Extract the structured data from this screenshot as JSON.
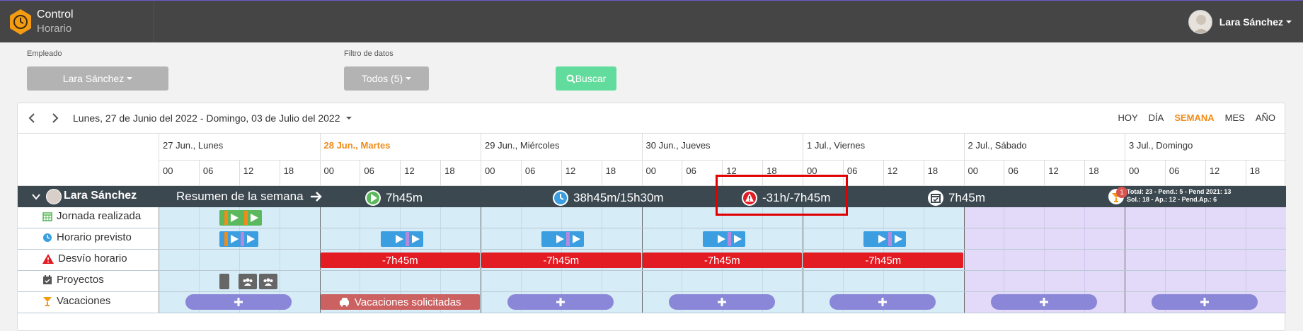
{
  "app": {
    "title": "Control",
    "subtitle": "Horario"
  },
  "user": {
    "name": "Lara Sánchez"
  },
  "filters": {
    "employee_label": "Empleado",
    "employee_value": "Lara Sánchez",
    "data_filter_label": "Filtro de datos",
    "data_filter_value": "Todos (5)",
    "search_button": "Buscar"
  },
  "calendar": {
    "range": "Lunes, 27 de Junio del 2022 - Domingo, 03 de Julio del 2022",
    "views": [
      "HOY",
      "DÍA",
      "SEMANA",
      "MES",
      "AÑO"
    ],
    "active_view": "SEMANA",
    "days": [
      {
        "label": "27 Jun., Lunes",
        "today": false
      },
      {
        "label": "28 Jun., Martes",
        "today": true
      },
      {
        "label": "29 Jun., Miércoles",
        "today": false
      },
      {
        "label": "30 Jun., Jueves",
        "today": false
      },
      {
        "label": "1 Jul., Viernes",
        "today": false
      },
      {
        "label": "2 Jul., Sábado",
        "today": false
      },
      {
        "label": "3 Jul., Domingo",
        "today": false
      }
    ],
    "hours": [
      "00",
      "06",
      "12",
      "18"
    ]
  },
  "summary": {
    "employee": "Lara Sánchez",
    "label": "Resumen de la semana",
    "worked": "7h45m",
    "scheduled": "38h45m/15h30m",
    "deviation": "-31h/-7h45m",
    "projects": "7h45m",
    "vacations_badge": "1",
    "vacations_line1": "Total: 23 - Pend.: 5 - Pend 2021: 13",
    "vacations_line2": "Sol.: 18 - Ap.: 12 - Pend.Ap.: 6"
  },
  "rows": {
    "worked": "Jornada realizada",
    "scheduled": "Horario previsto",
    "deviation": "Desvío horario",
    "projects": "Proyectos",
    "vacations": "Vacaciones"
  },
  "deviation_bars": [
    "-7h45m",
    "-7h45m",
    "-7h45m",
    "-7h45m"
  ],
  "vacation_requested": "Vacaciones solicitadas",
  "colors": {
    "accent": "#f08c1a",
    "green": "#5cb85c",
    "blue": "#3a9ee0",
    "red": "#e31b23",
    "purple_pill": "#8b87d8"
  }
}
